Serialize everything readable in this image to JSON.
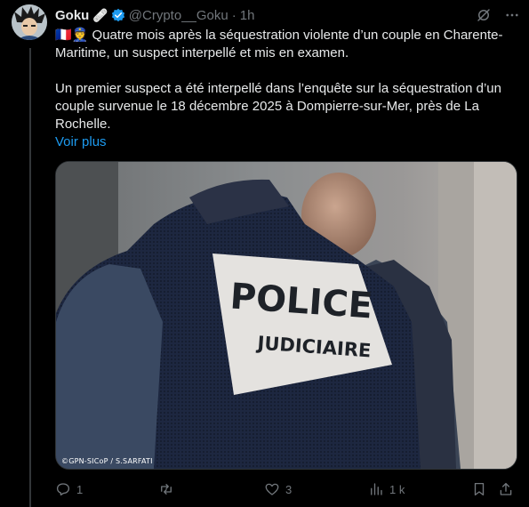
{
  "post": {
    "author_name": "Goku",
    "badge_emoji": "🩹",
    "handle": "@Crypto__Goku",
    "separator": "·",
    "time": "1h",
    "flag_emoji": "🇫🇷👮",
    "paragraph1": "Quatre mois après la séquestration violente d’un couple en Charente-Maritime, un suspect interpellé et mis en examen.",
    "paragraph2": "Un premier suspect a été interpellé dans l’enquête sur la séquestration d’un couple survenue le 18 décembre 2025 à Dompierre-sur-Mer, près de La Rochelle.",
    "show_more": "Voir plus"
  },
  "image": {
    "patch_line1": "POLICE",
    "patch_line2": "JUDICIAIRE",
    "credit": "©GPN-SICoP / S.SARFATI"
  },
  "actions": {
    "replies": "1",
    "reposts": "",
    "likes": "3",
    "views": "1 k"
  },
  "colors": {
    "background": "#000000",
    "text": "#e7e9ea",
    "muted": "#71767b",
    "link": "#1d9bf0",
    "verified": "#1d9bf0"
  }
}
